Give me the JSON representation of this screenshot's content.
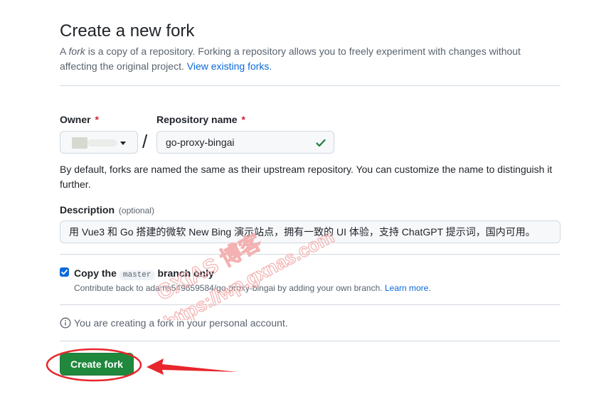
{
  "page": {
    "title": "Create a new fork",
    "subtitle_prefix": "A ",
    "subtitle_em": "fork",
    "subtitle_rest": " is a copy of a repository. Forking a repository allows you to freely experiment with changes without affecting the original project.",
    "view_forks_link": "View existing forks."
  },
  "owner": {
    "label": "Owner",
    "required_mark": "*"
  },
  "repo": {
    "label": "Repository name",
    "required_mark": "*",
    "value": "go-proxy-bingai",
    "valid_icon": "check-icon"
  },
  "hint": "By default, forks are named the same as their upstream repository. You can customize the name to distinguish it further.",
  "description": {
    "label": "Description",
    "optional": "(optional)",
    "value": "用 Vue3 和 Go 搭建的微软 New Bing 演示站点，拥有一致的 UI 体验，支持 ChatGPT 提示词，国内可用。"
  },
  "copy_branch": {
    "checked": true,
    "label_prefix": "Copy the",
    "branch": "master",
    "label_suffix": "branch only",
    "subtext": "Contribute back to adams549659584/go-proxy-bingai by adding your own branch.",
    "learn_more": "Learn more."
  },
  "info": {
    "icon": "info-icon",
    "text": "You are creating a fork in your personal account."
  },
  "create_button": {
    "label": "Create fork"
  },
  "watermark": {
    "line1": "GXIAS 博客",
    "line2": "https://wp.gxnas.com"
  },
  "colors": {
    "accent": "#0969da",
    "primary_button": "#1f883d",
    "annotation": "#e8262c",
    "watermark": "#f3b1b1"
  }
}
